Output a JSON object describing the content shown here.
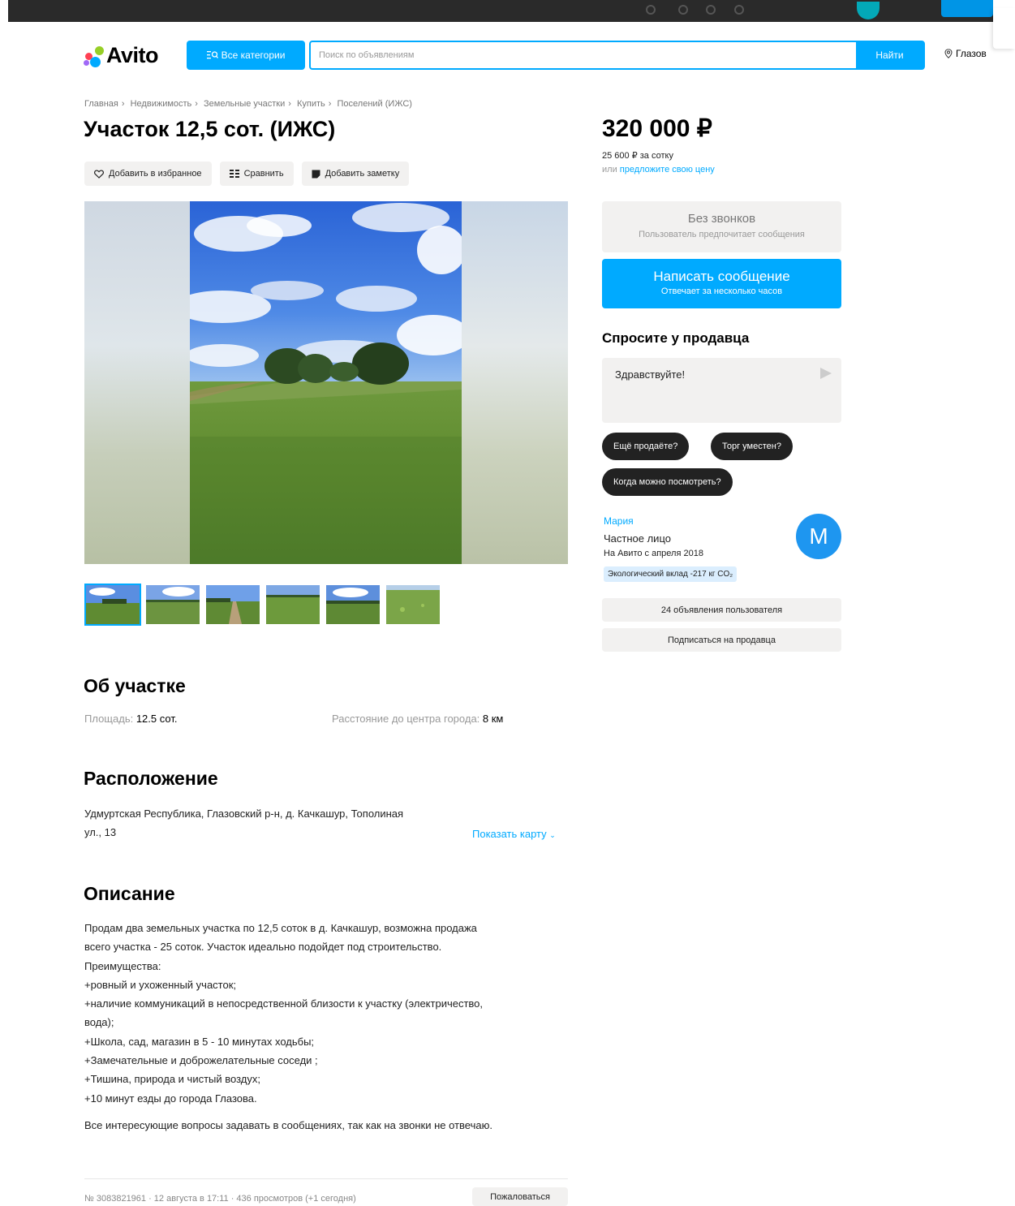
{
  "colors": {
    "accent": "#00aaff",
    "topbar": "#2a2a2a",
    "chip": "#222222",
    "avatar": "#1e96f0"
  },
  "header": {
    "logo": "Avito",
    "categories_label": "Все категории",
    "search_placeholder": "Поиск по объявлениям",
    "search_button": "Найти",
    "location": "Глазов"
  },
  "breadcrumb": [
    "Главная",
    "Недвижимость",
    "Земельные участки",
    "Купить",
    "Поселений (ИЖС)"
  ],
  "listing": {
    "title": "Участок 12,5 сот. (ИЖС)",
    "actions": {
      "favorite": "Добавить в избранное",
      "compare": "Сравнить",
      "note": "Добавить заметку"
    },
    "thumbnail_count": 6
  },
  "about": {
    "title": "Об участке",
    "area_label": "Площадь:",
    "area_value": "12.5 сот.",
    "distance_label": "Расстояние до центра города:",
    "distance_value": "8 км"
  },
  "location": {
    "title": "Расположение",
    "address_line1": "Удмуртская Республика, Глазовский р-н, д. Качкашур, Тополиная",
    "address_line2": "ул., 13",
    "map_link": "Показать карту"
  },
  "description": {
    "title": "Описание",
    "lines": [
      "Продам два земельных участка по 12,5 соток в д. Качкашур, возможна продажа",
      "всего участка - 25 соток. Участок идеально подойдет под строительство.",
      "Преимущества:",
      "+ровный и ухоженный участок;",
      "+наличие коммуникаций в непосредственной близости к участку (электричество,",
      "вода);",
      "+Школа, сад, магазин в 5 - 10 минутах ходьбы;",
      "+Замечательные и доброжелательные соседи ;",
      "+Тишина, природа и чистый воздух;",
      "+10 минут езды до города Глазова."
    ],
    "closing": "Все интересующие вопросы задавать в сообщениях, так как на звонки не отвечаю."
  },
  "footer": {
    "meta": "№ 3083821961 · 12 августа в 17:11 · 436 просмотров (+1 сегодня)",
    "complain": "Пожаловаться"
  },
  "sidebar": {
    "price": "320 000 ₽",
    "per_unit": "25 600 ₽ за сотку",
    "offer_prefix": "или ",
    "offer_link": "предложите свою цену",
    "no_calls_title": "Без звонков",
    "no_calls_sub": "Пользователь предпочитает сообщения",
    "write_title": "Написать сообщение",
    "write_sub": "Отвечает за несколько часов",
    "ask_title": "Спросите у продавца",
    "ask_text": "Здравствуйте!",
    "chips": [
      "Ещё продаёте?",
      "Торг уместен?",
      "Когда можно посмотреть?"
    ],
    "seller_name": "Мария",
    "seller_type": "Частное лицо",
    "seller_since": "На Авито с апреля 2018",
    "eco": "Экологический вклад -217 кг CO₂",
    "avatar_letter": "М",
    "listings_btn": "24 объявления пользователя",
    "subscribe_btn": "Подписаться на продавца"
  }
}
